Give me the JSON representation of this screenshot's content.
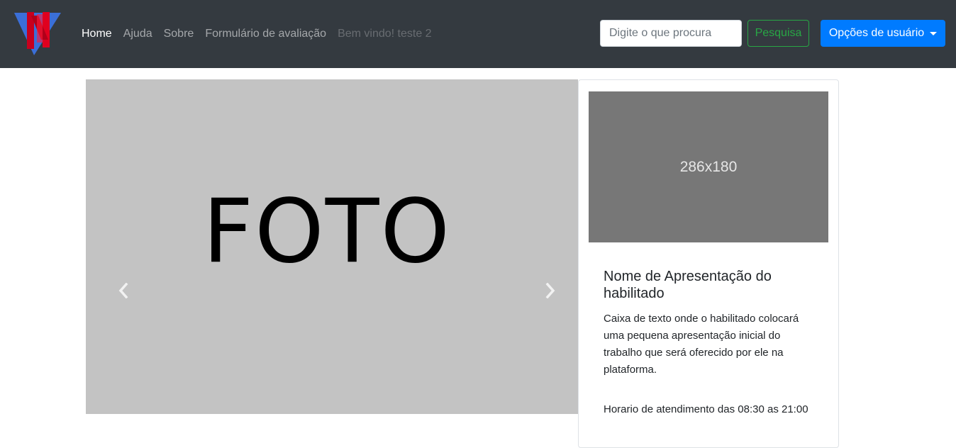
{
  "brand": {
    "logo_icon": "brand-logo-icon",
    "colors": {
      "red": "#d0021b",
      "blue": "#3b6fd8"
    }
  },
  "nav": {
    "links": [
      {
        "label": "Home",
        "state": "active"
      },
      {
        "label": "Ajuda",
        "state": "normal"
      },
      {
        "label": "Sobre",
        "state": "normal"
      },
      {
        "label": "Formulário de avaliação",
        "state": "normal"
      },
      {
        "label": "Bem vindo! teste 2",
        "state": "disabled"
      }
    ]
  },
  "search": {
    "placeholder": "Digite o que procura",
    "value": "",
    "button_label": "Pesquisa"
  },
  "user_menu": {
    "label": "Opções de usuário"
  },
  "carousel": {
    "slide_text": "FOTO",
    "prev_icon": "chevron-left-icon",
    "next_icon": "chevron-right-icon"
  },
  "card": {
    "image_label": "286x180",
    "title": "Nome de Apresentação do habilitado",
    "text": "Caixa de texto onde o habilitado colocará uma pequena apresentação inicial do trabalho que será oferecido por ele na plataforma.",
    "hours": "Horario de atendimento das 08:30 as 21:00"
  },
  "colors": {
    "navbar_bg": "#343a40",
    "primary": "#007bff",
    "success": "#28a745",
    "carousel_bg": "#c3c3c3",
    "placeholder_img": "#777777"
  }
}
